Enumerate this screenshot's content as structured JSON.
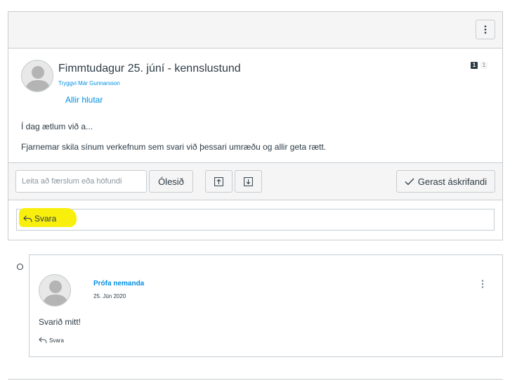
{
  "topic": {
    "title": "Fimmtudagur 25. júní - kennslustund",
    "author": "Tryggvi Már Gunnarsson",
    "sections": "Allir hlutar",
    "unread_count": "1",
    "total_count": "1",
    "body": [
      "Í dag ætlum við a...",
      "Fjarnemar skila sínum verkefnum sem svari við þessari umræðu og allir geta rætt."
    ],
    "options_icon": "kebab-vertical-icon"
  },
  "toolbar": {
    "search_placeholder": "Leita að færslum eða höfundi",
    "unread_label": "Ólesið",
    "collapse_icon": "arrow-up-box-icon",
    "expand_icon": "arrow-down-box-icon",
    "subscribe_label": "Gerast áskrifandi",
    "subscribe_icon": "checkmark-icon"
  },
  "reply": {
    "label": "Svara",
    "icon": "reply-arrow-icon",
    "highlight_color": "#f8f00c"
  },
  "entries": [
    {
      "author": "Prófa nemanda",
      "date": "25. Jún 2020",
      "body": "Svarið mitt!",
      "reply_label": "Svara"
    }
  ],
  "colors": {
    "link": "#008ee2",
    "text": "#2d3b45",
    "border": "#c7cdd1",
    "panel": "#f5f5f5"
  }
}
